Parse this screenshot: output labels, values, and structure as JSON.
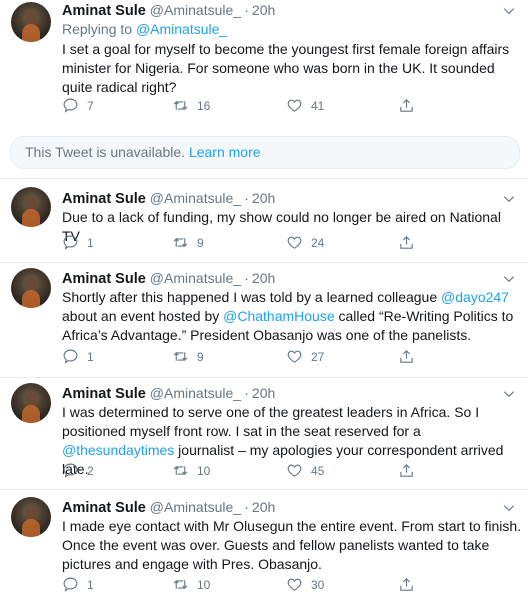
{
  "colors": {
    "link": "#1da1f2",
    "muted": "#657786",
    "text": "#14171a"
  },
  "unavailable": {
    "text": "This Tweet is unavailable.",
    "learn_more": "Learn more"
  },
  "tweets": [
    {
      "name": "Aminat Sule",
      "handle": "@Aminatsule_",
      "time": "20h",
      "replying_label": "Replying to",
      "replying_to": "@Aminatsule_",
      "text": "I set a goal for myself to become the youngest first female foreign affairs minister for Nigeria. For someone who was born in the UK. It sounded quite radical right?",
      "replies": "7",
      "retweets": "16",
      "likes": "41"
    },
    {
      "name": "Aminat Sule",
      "handle": "@Aminatsule_",
      "time": "20h",
      "text": "Due to a lack of funding, my show could no longer be aired on National TV",
      "replies": "1",
      "retweets": "9",
      "likes": "24"
    },
    {
      "name": "Aminat Sule",
      "handle": "@Aminatsule_",
      "time": "20h",
      "text_parts": {
        "a": "Shortly after this happened I was told by a learned colleague ",
        "m1": "@dayo247",
        "b": " about an event hosted by ",
        "m2": "@ChathamHouse",
        "c": " called “Re-Writing Politics to Africa’s Advantage.” President Obasanjo was one of the panelists."
      },
      "replies": "1",
      "retweets": "9",
      "likes": "27"
    },
    {
      "name": "Aminat Sule",
      "handle": "@Aminatsule_",
      "time": "20h",
      "text_parts": {
        "a": "I was determined to serve one of the greatest leaders in Africa. So I positioned myself front row. I sat in the seat reserved for a ",
        "m1": "@thesundaytimes",
        "b": " journalist – my apologies your correspondent arrived late."
      },
      "replies": "2",
      "retweets": "10",
      "likes": "45"
    },
    {
      "name": "Aminat Sule",
      "handle": "@Aminatsule_",
      "time": "20h",
      "text": "I made eye contact with Mr Olusegun the entire event. From start to finish. Once the event was over. Guests and fellow panelists wanted to take pictures and engage with Pres. Obasanjo.",
      "replies": "1",
      "retweets": "10",
      "likes": "30"
    }
  ]
}
